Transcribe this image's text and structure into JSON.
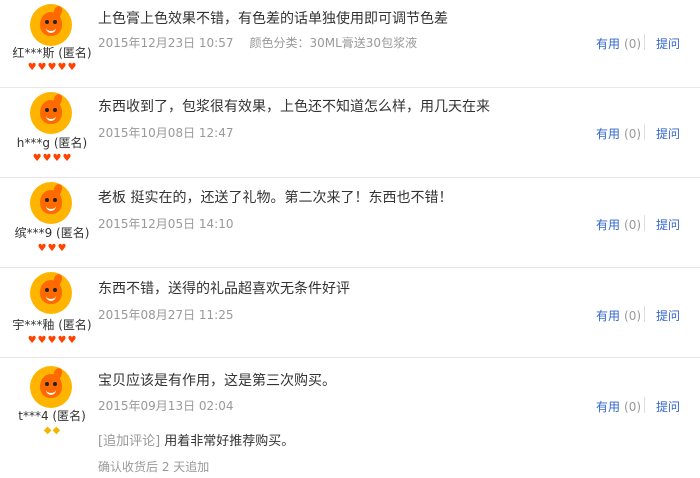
{
  "reviews": [
    {
      "nick": "红***斯 (匿名)",
      "rank": [
        "heart",
        "heart",
        "heart",
        "heart",
        "heart"
      ],
      "content": "上色膏上色效果不错，有色差的话单独使用即可调节色差",
      "date": "2015年12月23日 10:57",
      "sku": "颜色分类：30ML膏送30包浆液",
      "useful_label": "有用",
      "useful_count": "(0)",
      "ask_label": "提问"
    },
    {
      "nick": "h***g (匿名)",
      "rank": [
        "heart",
        "heart",
        "heart",
        "heart"
      ],
      "content": "东西收到了，包浆很有效果，上色还不知道怎么样，用几天在来",
      "date": "2015年10月08日 12:47",
      "useful_label": "有用",
      "useful_count": "(0)",
      "ask_label": "提问"
    },
    {
      "nick": "缤***9 (匿名)",
      "rank": [
        "heart",
        "heart",
        "heart"
      ],
      "content": "老板 挺实在的，还送了礼物。第二次来了！东西也不错！",
      "date": "2015年12月05日 14:10",
      "useful_label": "有用",
      "useful_count": "(0)",
      "ask_label": "提问"
    },
    {
      "nick": "宇***釉 (匿名)",
      "rank": [
        "heart",
        "heart",
        "heart",
        "heart",
        "heart"
      ],
      "content": "东西不错，送得的礼品超喜欢无条件好评",
      "date": "2015年08月27日 11:25",
      "useful_label": "有用",
      "useful_count": "(0)",
      "ask_label": "提问"
    },
    {
      "nick": "t***4 (匿名)",
      "rank": [
        "gem",
        "gem"
      ],
      "content": "宝贝应该是有作用，这是第三次购买。",
      "date": "2015年09月13日 02:04",
      "useful_label": "有用",
      "useful_count": "(0)",
      "ask_label": "提问",
      "append_tag": "[追加评论]",
      "append_text": "用着非常好推荐购买。",
      "append_after": "确认收货后 2 天追加"
    }
  ],
  "colors": {
    "link": "#3366cc",
    "muted": "#999999",
    "heart": "#ff4400",
    "gem": "#f5b400",
    "avatar_bg": "#ffb400"
  },
  "icons": {
    "heart": "heart-rank-icon",
    "gem": "diamond-rank-icon"
  }
}
